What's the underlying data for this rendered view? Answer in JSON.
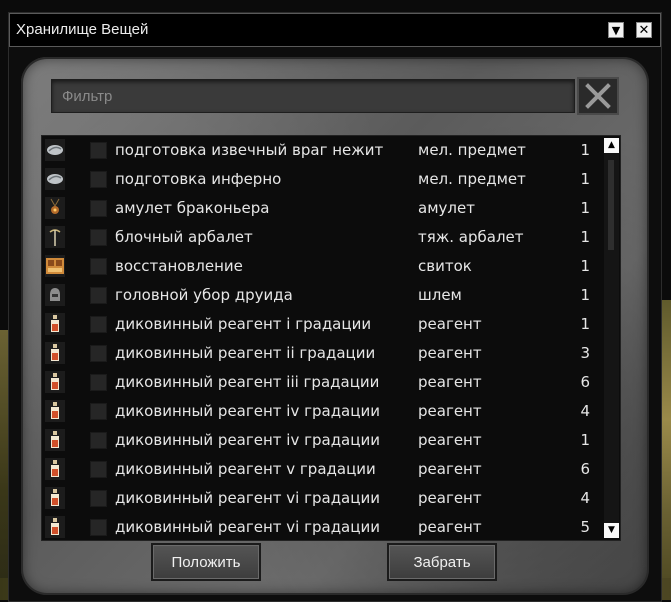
{
  "window": {
    "title": "Хранилище Вещей"
  },
  "filter": {
    "placeholder": "Фильтр",
    "value": ""
  },
  "items": [
    {
      "name": " подготовка извечный враг нежит",
      "type": "мел. предмет",
      "qty": "1",
      "icon": "stone-icon"
    },
    {
      "name": " подготовка инферно",
      "type": "мел. предмет",
      "qty": "1",
      "icon": "stone-icon"
    },
    {
      "name": "амулет браконьера",
      "type": "амулет",
      "qty": "1",
      "icon": "amulet-icon"
    },
    {
      "name": "блочный арбалет",
      "type": "тяж. арбалет",
      "qty": "1",
      "icon": "crossbow-icon"
    },
    {
      "name": "восстановление",
      "type": "свиток",
      "qty": "1",
      "icon": "scroll-icon"
    },
    {
      "name": "головной убор друида",
      "type": "шлем",
      "qty": "1",
      "icon": "helmet-icon"
    },
    {
      "name": "диковинный реагент i градации",
      "type": "реагент",
      "qty": "1",
      "icon": "reagent-icon"
    },
    {
      "name": "диковинный реагент ii градации",
      "type": "реагент",
      "qty": "3",
      "icon": "reagent-icon"
    },
    {
      "name": "диковинный реагент iii градации",
      "type": "реагент",
      "qty": "6",
      "icon": "reagent-icon"
    },
    {
      "name": "диковинный реагент iv градации",
      "type": "реагент",
      "qty": "4",
      "icon": "reagent-icon"
    },
    {
      "name": "диковинный реагент iv градации",
      "type": "реагент",
      "qty": "1",
      "icon": "reagent-icon"
    },
    {
      "name": "диковинный реагент v градации",
      "type": "реагент",
      "qty": "6",
      "icon": "reagent-icon"
    },
    {
      "name": "диковинный реагент vi градации",
      "type": "реагент",
      "qty": "4",
      "icon": "reagent-icon"
    },
    {
      "name": "диковинный реагент vi градации",
      "type": "реагент",
      "qty": "5",
      "icon": "reagent-icon"
    }
  ],
  "buttons": {
    "put": "Положить",
    "take": "Забрать"
  },
  "colors": {
    "text": "#e6e6e6",
    "panel": "#0c0c0c",
    "stone": "#6e6e6e"
  }
}
